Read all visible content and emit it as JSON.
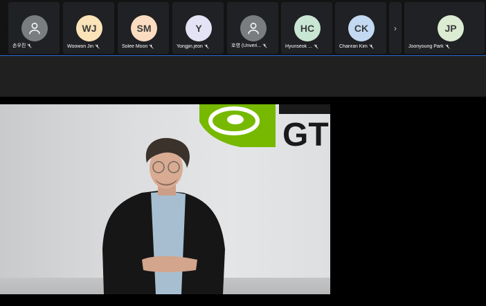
{
  "participants": [
    {
      "initials": "",
      "name": "손우진",
      "avatar_color": "#7a7d80",
      "generic": true
    },
    {
      "initials": "WJ",
      "name": "Woowon Jin",
      "avatar_color": "#fbe3b9",
      "generic": false
    },
    {
      "initials": "SM",
      "name": "Solee Moon",
      "avatar_color": "#fcdcc0",
      "generic": false
    },
    {
      "initials": "Y",
      "name": "Yongjin.jeon",
      "avatar_color": "#e3e3f5",
      "generic": false
    },
    {
      "initials": "",
      "name": "호영 (Unveri...",
      "avatar_color": "#7a7d80",
      "generic": true
    },
    {
      "initials": "HC",
      "name": "Hyunseok ...",
      "avatar_color": "#c9e6d4",
      "generic": false
    },
    {
      "initials": "CK",
      "name": "Chanran Kim",
      "avatar_color": "#c3d9f2",
      "generic": false
    }
  ],
  "last_participant": {
    "initials": "JP",
    "name": "Joonyoung Park",
    "avatar_color": "#dcecd3"
  },
  "icons": {
    "prev": "chevron-left-icon",
    "next": "chevron-right-icon",
    "mic": "mic-off-icon"
  },
  "colors": {
    "accent": "#2a6bd8",
    "logo_green": "#76b900"
  },
  "video": {
    "logo_text": "GT"
  }
}
